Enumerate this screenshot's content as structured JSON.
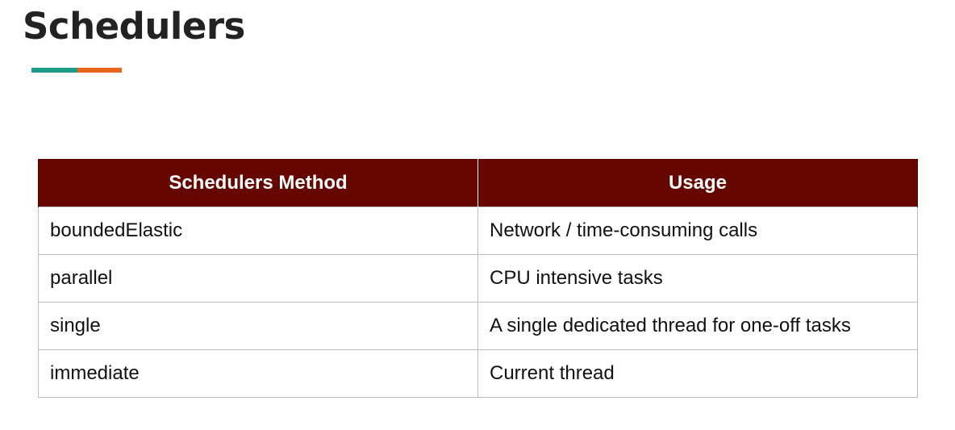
{
  "title": "Schedulers",
  "colors": {
    "title_text": "#222222",
    "accent_teal": "#1e9b8a",
    "accent_orange": "#e8661c",
    "header_bg": "#660601",
    "header_text": "#ffffff",
    "grid_line": "#bdbdbd"
  },
  "table": {
    "headers": [
      "Schedulers Method",
      "Usage"
    ],
    "rows": [
      [
        "boundedElastic",
        "Network / time-consuming calls"
      ],
      [
        "parallel",
        "CPU intensive tasks"
      ],
      [
        "single",
        "A single dedicated thread for one-off tasks"
      ],
      [
        "immediate",
        "Current thread"
      ]
    ]
  }
}
